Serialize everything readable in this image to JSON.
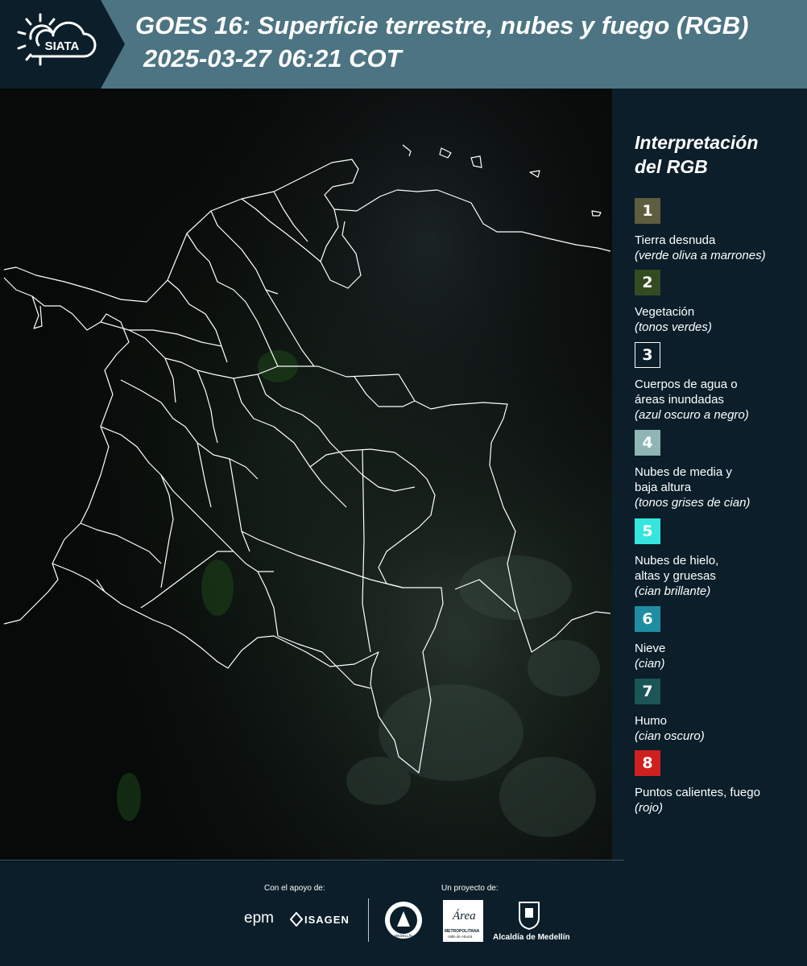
{
  "header": {
    "logo_text": "SIATA",
    "title_line1": "GOES 16: Superficie terrestre, nubes y fuego (RGB)",
    "title_line2": "2025-03-27 06:21 COT"
  },
  "legend": {
    "title_line1": "Interpretación",
    "title_line2": "del RGB",
    "items": [
      {
        "num": "1",
        "color": "#5e5d40",
        "label_lines": [
          "Tierra desnuda"
        ],
        "sub": "(verde oliva a marrones)"
      },
      {
        "num": "2",
        "color": "#344b22",
        "label_lines": [
          "Vegetación"
        ],
        "sub": "(tonos verdes)"
      },
      {
        "num": "3",
        "color": "#0b1e2a",
        "label_lines": [
          "Cuerpos de agua o",
          "áreas inundadas"
        ],
        "sub": "(azul oscuro a negro)"
      },
      {
        "num": "4",
        "color": "#8fb5b4",
        "label_lines": [
          "Nubes de media y",
          "baja altura"
        ],
        "sub": "(tonos grises de cian)"
      },
      {
        "num": "5",
        "color": "#35e6df",
        "label_lines": [
          "Nubes de hielo,",
          "altas y gruesas"
        ],
        "sub": "(cian brillante)"
      },
      {
        "num": "6",
        "color": "#1f8ea3",
        "label_lines": [
          "Nieve"
        ],
        "sub": "(cian)"
      },
      {
        "num": "7",
        "color": "#1b5556",
        "label_lines": [
          "Humo"
        ],
        "sub": "(cian oscuro)"
      },
      {
        "num": "8",
        "color": "#d01f1f",
        "label_lines": [
          "Puntos calientes, fuego"
        ],
        "sub": "(rojo)"
      }
    ]
  },
  "footer": {
    "support_caption": "Con el apoyo de:",
    "project_caption": "Un proyecto de:",
    "sponsor_epm": "epm",
    "sponsor_isagen": "ISAGEN",
    "area_logo_line1": "Área",
    "area_logo_line2": "METROPOLITANA",
    "area_logo_line3": "Valle de Aburrá",
    "alcaldia": "Alcaldía de Medellín",
    "seal_text": "MEDELLÍN"
  },
  "colors": {
    "header_bg": "#4c7482",
    "logo_bg": "#0b1e2a",
    "page_bg": "#0b1e2a",
    "map_bg": "#050807",
    "border_lines": "#ffffff"
  }
}
